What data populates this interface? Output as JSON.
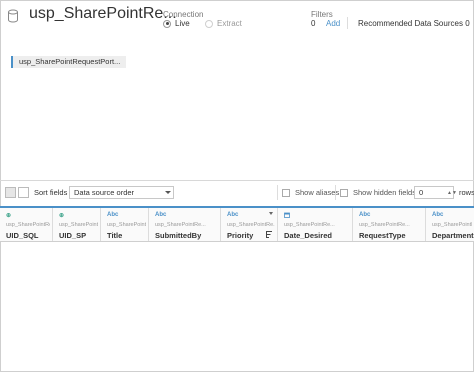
{
  "header": {
    "title": "usp_SharePointRe...",
    "connection": {
      "label": "Connection",
      "options": [
        "Live",
        "Extract"
      ],
      "selected": "Live"
    },
    "filters": {
      "label": "Filters",
      "count": "0",
      "add_label": "Add"
    },
    "recommended": "Recommended Data Sources",
    "recommended_count": "0"
  },
  "canvas": {
    "table_pill": "usp_SharePointRequestPort..."
  },
  "toolbar": {
    "sort_label": "Sort fields",
    "sort_value": "Data source order",
    "show_aliases": "Show aliases",
    "show_hidden": "Show hidden fields",
    "rows_value": "0",
    "rows_label": "rows"
  },
  "grid": {
    "columns": [
      {
        "type_icon": "globe-icon",
        "type": "⊕",
        "source": "usp_SharePointRe...",
        "name": "UID_SQL"
      },
      {
        "type_icon": "globe-icon",
        "type": "⊕",
        "source": "usp_SharePointRe...",
        "name": "UID_SP"
      },
      {
        "type_icon": "string-icon",
        "type": "Abc",
        "source": "usp_SharePointRe...",
        "name": "Title"
      },
      {
        "type_icon": "string-icon",
        "type": "Abc",
        "source": "usp_SharePointRe...",
        "name": "SubmittedBy"
      },
      {
        "type_icon": "string-icon",
        "type": "Abc",
        "source": "usp_SharePointRe...",
        "name": "Priority"
      },
      {
        "type_icon": "calendar-icon",
        "type": "",
        "source": "usp_SharePointRe...",
        "name": "Date_Desired"
      },
      {
        "type_icon": "string-icon",
        "type": "Abc",
        "source": "usp_SharePointRe...",
        "name": "RequestType"
      },
      {
        "type_icon": "string-icon",
        "type": "Abc",
        "source": "usp_SharePointRe...",
        "name": "Department"
      }
    ]
  },
  "colors": {
    "accent": "#4a90c8",
    "geo": "#41a58d"
  }
}
